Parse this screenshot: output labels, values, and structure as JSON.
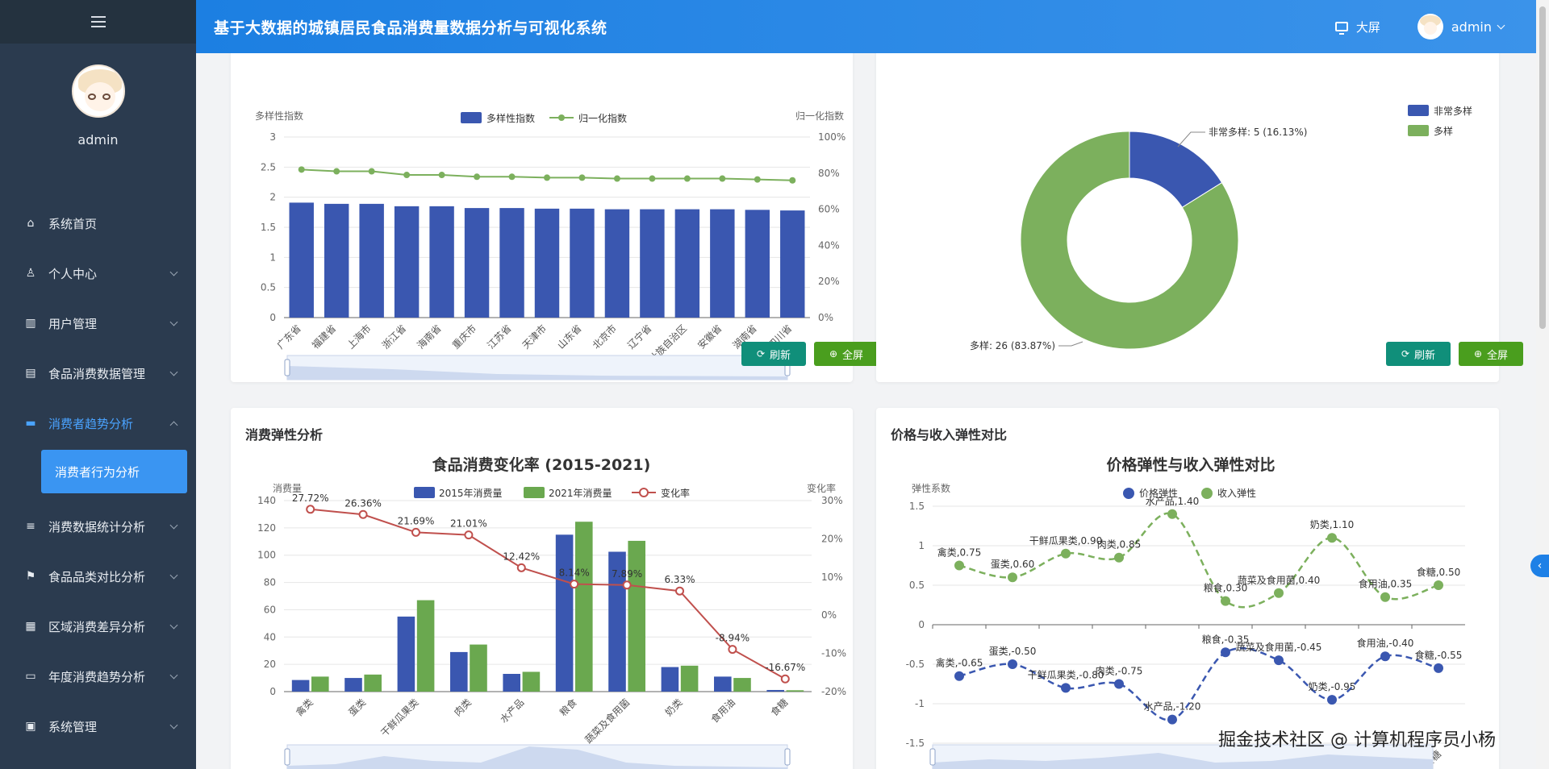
{
  "sidebar": {
    "username": "admin",
    "menu": [
      {
        "label": "系统首页",
        "icon": "home-icon",
        "has_children": false
      },
      {
        "label": "个人中心",
        "icon": "user-icon",
        "has_children": true
      },
      {
        "label": "用户管理",
        "icon": "users-icon",
        "has_children": true
      },
      {
        "label": "食品消费数据管理",
        "icon": "clipboard-icon",
        "has_children": true
      },
      {
        "label": "消费者趋势分析",
        "icon": "chat-icon",
        "has_children": true,
        "expanded": true
      },
      {
        "label": "消费数据统计分析",
        "icon": "list-icon",
        "has_children": true
      },
      {
        "label": "食品品类对比分析",
        "icon": "flag-icon",
        "has_children": true
      },
      {
        "label": "区域消费差异分析",
        "icon": "grid-icon",
        "has_children": true
      },
      {
        "label": "年度消费趋势分析",
        "icon": "monitor-icon",
        "has_children": true
      },
      {
        "label": "系统管理",
        "icon": "briefcase-icon",
        "has_children": true
      }
    ],
    "submenu_active": "消费者行为分析"
  },
  "header": {
    "title": "基于大数据的城镇居民食品消费量数据分析与可视化系统",
    "bigscreen_label": "大屏",
    "username": "admin"
  },
  "buttons": {
    "refresh": "刷新",
    "fullscreen": "全屏"
  },
  "cards": {
    "elasticity_title": "消费弹性分析",
    "price_income_title": "价格与收入弹性对比"
  },
  "chart_data": [
    {
      "type": "bar",
      "id": "diversity",
      "title": "",
      "ylabel_left": "多样性指数",
      "ylabel_right": "归一化指数",
      "ylim_left": [
        0,
        3
      ],
      "ylim_right": [
        0,
        100
      ],
      "yticks_left": [
        "0",
        "0.5",
        "1",
        "1.5",
        "2",
        "2.5",
        "3"
      ],
      "yticks_right": [
        "0%",
        "20%",
        "40%",
        "60%",
        "80%",
        "100%"
      ],
      "legend": [
        "多样性指数",
        "归一化指数"
      ],
      "categories": [
        "广东省",
        "福建省",
        "上海市",
        "浙江省",
        "海南省",
        "重庆市",
        "江苏省",
        "天津市",
        "山东省",
        "北京市",
        "辽宁省",
        "广西壮族自治区",
        "安徽省",
        "湖南省",
        "四川省"
      ],
      "series": [
        {
          "name": "多样性指数",
          "type": "bar",
          "color": "#3a57b0",
          "values": [
            1.91,
            1.89,
            1.89,
            1.85,
            1.85,
            1.82,
            1.82,
            1.81,
            1.81,
            1.8,
            1.8,
            1.8,
            1.8,
            1.79,
            1.78
          ]
        },
        {
          "name": "归一化指数",
          "type": "line",
          "color": "#7cb05d",
          "values": [
            82,
            81,
            81,
            79,
            79,
            78,
            78,
            77.5,
            77.5,
            77,
            77,
            77,
            77,
            76.5,
            76
          ]
        }
      ],
      "zoom_label": "广西壮族自治区"
    },
    {
      "type": "pie",
      "id": "diversity-pie",
      "legend": [
        "非常多样",
        "多样"
      ],
      "slices": [
        {
          "name": "非常多样",
          "value": 5,
          "percent": 16.13,
          "color": "#3a57b0",
          "label": "非常多样: 5 (16.13%)"
        },
        {
          "name": "多样",
          "value": 26,
          "percent": 83.87,
          "color": "#7cb05d",
          "label": "多样: 26 (83.87%)"
        }
      ]
    },
    {
      "type": "bar",
      "id": "change-rate",
      "title": "食品消费变化率 (2015-2021)",
      "ylabel_left": "消费量",
      "ylabel_right": "变化率",
      "ylim_left": [
        0,
        140
      ],
      "ylim_right": [
        -20,
        30
      ],
      "yticks_left": [
        "0",
        "20",
        "40",
        "60",
        "80",
        "100",
        "120",
        "140"
      ],
      "yticks_right": [
        "-20%",
        "-10%",
        "0%",
        "10%",
        "20%",
        "30%"
      ],
      "legend": [
        "2015年消费量",
        "2021年消费量",
        "变化率"
      ],
      "categories": [
        "禽类",
        "蛋类",
        "干鲜瓜果类",
        "肉类",
        "水产品",
        "粮食",
        "蔬菜及食用菌",
        "奶类",
        "食用油",
        "食糖"
      ],
      "series": [
        {
          "name": "2015年消费量",
          "type": "bar",
          "color": "#3a57b0",
          "values": [
            8.5,
            10,
            55,
            29,
            13,
            115,
            102.5,
            18,
            11,
            1.2
          ]
        },
        {
          "name": "2021年消费量",
          "type": "bar",
          "color": "#6aa84f",
          "values": [
            11,
            12.5,
            67,
            34.5,
            14.5,
            124.5,
            110.5,
            19,
            10,
            1
          ]
        },
        {
          "name": "变化率",
          "type": "line",
          "color": "#c0504d",
          "values": [
            27.72,
            26.36,
            21.69,
            21.01,
            12.42,
            8.14,
            7.89,
            6.33,
            -8.94,
            -16.67
          ],
          "labels": [
            "27.72%",
            "26.36%",
            "21.69%",
            "21.01%",
            "12.42%",
            "8.14%",
            "7.89%",
            "6.33%",
            "-8.94%",
            "-16.67%"
          ]
        }
      ]
    },
    {
      "type": "line",
      "id": "elasticity",
      "title": "价格弹性与收入弹性对比",
      "ylabel": "弹性系数",
      "ylim": [
        -1.5,
        1.5
      ],
      "yticks": [
        "-1.5",
        "-1",
        "-0.5",
        "0",
        "0.5",
        "1",
        "1.5"
      ],
      "legend": [
        "价格弹性",
        "收入弹性"
      ],
      "categories": [
        "禽类",
        "蛋类",
        "干鲜瓜果类",
        "肉类",
        "水产品",
        "粮食",
        "蔬菜及食用菌",
        "奶类",
        "食用油",
        "食糖"
      ],
      "series": [
        {
          "name": "价格弹性",
          "color": "#3a57b0",
          "values": [
            -0.65,
            -0.5,
            -0.8,
            -0.75,
            -1.2,
            -0.35,
            -0.45,
            -0.95,
            -0.4,
            -0.55
          ],
          "labels": [
            "禽类,-0.65",
            "蛋类,-0.50",
            "干鲜瓜果类,-0.80",
            "肉类,-0.75",
            "水产品,-1.20",
            "粮食,-0.35",
            "蔬菜及食用菌,-0.45",
            "奶类,-0.95",
            "食用油,-0.40",
            "食糖,-0.55"
          ]
        },
        {
          "name": "收入弹性",
          "color": "#7cb05d",
          "values": [
            0.75,
            0.6,
            0.9,
            0.85,
            1.4,
            0.3,
            0.4,
            1.1,
            0.35,
            0.5
          ],
          "labels": [
            "禽类,0.75",
            "蛋类,0.60",
            "干鲜瓜果类,0.90",
            "肉类,0.85",
            "水产品,1.40",
            "粮食,0.30",
            "蔬菜及食用菌,0.40",
            "奶类,1.10",
            "食用油,0.35",
            "食糖,0.50"
          ]
        }
      ]
    }
  ],
  "watermark": "掘金技术社区 @ 计算机程序员小杨"
}
